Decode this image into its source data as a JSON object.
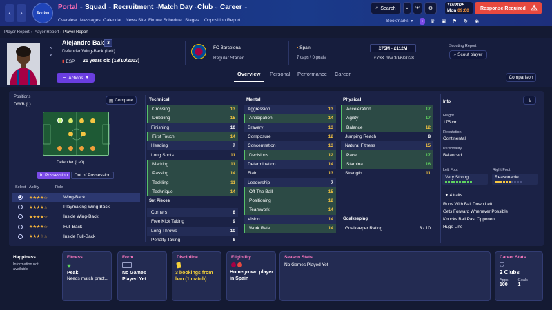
{
  "nav": {
    "menus": [
      {
        "label": "Portal",
        "active": true
      },
      {
        "label": "Squad",
        "active": false
      },
      {
        "label": "Recruitment",
        "active": false
      },
      {
        "label": "Match Day",
        "active": false
      },
      {
        "label": "Club",
        "active": false
      },
      {
        "label": "Career",
        "active": false
      }
    ],
    "submenu": [
      "Overview",
      "Messages",
      "Calendar",
      "News Site",
      "Fixture Schedule",
      "Stages",
      "Opposition Report"
    ],
    "club_badge": "Everton",
    "search_label": "Search",
    "date_line": "7/7/2025",
    "day_label": "Mon",
    "time_label": "09:00",
    "response_label": "Response Required",
    "bookmarks_label": "Bookmarks"
  },
  "breadcrumbs": [
    "Player Report",
    "Player Report",
    "Player Report"
  ],
  "player": {
    "name": "Alejandro Balde",
    "number": "3",
    "position": "Defender/Wing-Back (Left)",
    "nation_code": "ESP",
    "age": "21 years old (18/10/2003)",
    "actions_label": "Actions",
    "club": "FC Barcelona",
    "club_role": "Regular Starter",
    "country": "Spain",
    "caps": "7 caps / 0 goals",
    "value": "£75M - £112M",
    "wage": "£73K p/w 30/6/2028",
    "scout_label": "Scouting Report",
    "scout_button": "Scout player"
  },
  "tabs": [
    {
      "label": "Overview",
      "active": true
    },
    {
      "label": "Personal",
      "active": false
    },
    {
      "label": "Performance",
      "active": false
    },
    {
      "label": "Career",
      "active": false
    }
  ],
  "comparison_label": "Comparison",
  "positions": {
    "title": "Positions",
    "code": "D/WB (L)",
    "compare_label": "Compare",
    "pitch_label": "Defender (Left)",
    "in_possession": "In Possession",
    "out_possession": "Out of Possession",
    "col_select": "Select",
    "col_ability": "Ability",
    "col_role": "Role",
    "roles": [
      {
        "name": "Wing-Back",
        "stars": "★★★★☆",
        "selected": true
      },
      {
        "name": "Playmaking Wing-Back",
        "stars": "★★★★☆",
        "selected": false
      },
      {
        "name": "Inside Wing-Back",
        "stars": "★★★★☆",
        "selected": false
      },
      {
        "name": "Full-Back",
        "stars": "★★★★☆",
        "selected": false
      },
      {
        "name": "Inside Full-Back",
        "stars": "★★★☆☆",
        "selected": false
      }
    ]
  },
  "technical": {
    "title": "Technical",
    "rows": [
      {
        "name": "Crossing",
        "value": "13",
        "tone": "y",
        "hl": true
      },
      {
        "name": "Dribbling",
        "value": "15",
        "tone": "y",
        "hl": true
      },
      {
        "name": "Finishing",
        "value": "10",
        "tone": "w",
        "hl": false
      },
      {
        "name": "First Touch",
        "value": "14",
        "tone": "y",
        "hl": true
      },
      {
        "name": "Heading",
        "value": "7",
        "tone": "w",
        "hl": false
      },
      {
        "name": "Long Shots",
        "value": "11",
        "tone": "y",
        "hl": false
      },
      {
        "name": "Marking",
        "value": "11",
        "tone": "y",
        "hl": true
      },
      {
        "name": "Passing",
        "value": "14",
        "tone": "y",
        "hl": true
      },
      {
        "name": "Tackling",
        "value": "11",
        "tone": "y",
        "hl": true
      },
      {
        "name": "Technique",
        "value": "14",
        "tone": "y",
        "hl": true
      }
    ]
  },
  "set_pieces": {
    "title": "Set Pieces",
    "rows": [
      {
        "name": "Corners",
        "value": "8",
        "tone": "w"
      },
      {
        "name": "Free Kick Taking",
        "value": "9",
        "tone": "w"
      },
      {
        "name": "Long Throws",
        "value": "10",
        "tone": "w"
      },
      {
        "name": "Penalty Taking",
        "value": "8",
        "tone": "w"
      }
    ]
  },
  "mental": {
    "title": "Mental",
    "rows": [
      {
        "name": "Aggression",
        "value": "13",
        "tone": "y",
        "hl": false
      },
      {
        "name": "Anticipation",
        "value": "14",
        "tone": "y",
        "hl": true
      },
      {
        "name": "Bravery",
        "value": "13",
        "tone": "y",
        "hl": false
      },
      {
        "name": "Composure",
        "value": "12",
        "tone": "y",
        "hl": false
      },
      {
        "name": "Concentration",
        "value": "13",
        "tone": "y",
        "hl": false
      },
      {
        "name": "Decisions",
        "value": "12",
        "tone": "y",
        "hl": true
      },
      {
        "name": "Determination",
        "value": "14",
        "tone": "y",
        "hl": false
      },
      {
        "name": "Flair",
        "value": "13",
        "tone": "y",
        "hl": false
      },
      {
        "name": "Leadership",
        "value": "7",
        "tone": "w",
        "hl": false
      },
      {
        "name": "Off The Ball",
        "value": "15",
        "tone": "y",
        "hl": true
      },
      {
        "name": "Positioning",
        "value": "12",
        "tone": "y",
        "hl": true
      },
      {
        "name": "Teamwork",
        "value": "14",
        "tone": "y",
        "hl": true
      },
      {
        "name": "Vision",
        "value": "14",
        "tone": "y",
        "hl": false
      },
      {
        "name": "Work Rate",
        "value": "14",
        "tone": "y",
        "hl": true
      }
    ]
  },
  "physical": {
    "title": "Physical",
    "rows": [
      {
        "name": "Acceleration",
        "value": "17",
        "tone": "g",
        "hl": true
      },
      {
        "name": "Agility",
        "value": "17",
        "tone": "g",
        "hl": true
      },
      {
        "name": "Balance",
        "value": "12",
        "tone": "y",
        "hl": true
      },
      {
        "name": "Jumping Reach",
        "value": "8",
        "tone": "w",
        "hl": false
      },
      {
        "name": "Natural Fitness",
        "value": "15",
        "tone": "y",
        "hl": false
      },
      {
        "name": "Pace",
        "value": "17",
        "tone": "g",
        "hl": true
      },
      {
        "name": "Stamina",
        "value": "16",
        "tone": "g",
        "hl": true
      },
      {
        "name": "Strength",
        "value": "11",
        "tone": "y",
        "hl": false
      }
    ]
  },
  "goalkeeping": {
    "title": "Goalkeeping",
    "rating_label": "Goalkeeper Rating",
    "rating_value": "3 / 10"
  },
  "info": {
    "title": "Info",
    "height_label": "Height",
    "height": "175 cm",
    "reputation_label": "Reputation",
    "reputation": "Continental",
    "personality_label": "Personality",
    "personality": "Balanced",
    "left_foot_label": "Left Foot",
    "left_foot": "Very Strong",
    "right_foot_label": "Right Foot",
    "right_foot": "Reasonable",
    "traits_label": "4 traits",
    "traits": [
      "Runs With Ball Down Left",
      "Gets Forward Whenever Possible",
      "Knocks Ball Past Opponent",
      "Hugs Line"
    ]
  },
  "cards": {
    "happiness_title": "Happiness",
    "happiness_text": "Information not available",
    "fitness_title": "Fitness",
    "fitness_value": "Peak",
    "fitness_sub": "Needs match pract...",
    "form_title": "Form",
    "form_value": "No Games Played Yet",
    "discipline_title": "Discipline",
    "discipline_value": "3 bookings from ban (1 match)",
    "eligibility_title": "Eligibility",
    "eligibility_value": "Homegrown player in Spain",
    "season_title": "Season Stats",
    "season_value": "No Games Played Yet",
    "career_title": "Career Stats",
    "career_value": "2 Clubs",
    "apps_label": "Apps",
    "apps": "100",
    "goals_label": "Goals",
    "goals": "1"
  },
  "colors": {
    "accent": "#ff6fb6",
    "topbar": "#1d2d7a",
    "alert": "#e8493f",
    "good": "#5fd25f",
    "mid": "#f4c542"
  }
}
